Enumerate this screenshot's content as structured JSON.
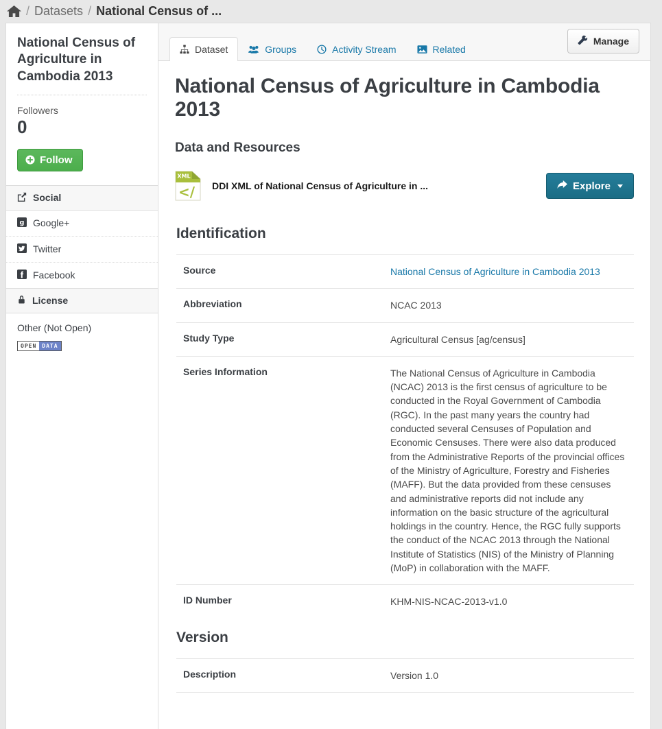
{
  "breadcrumb": {
    "home_icon": "home-icon",
    "separator": "/",
    "datasets_label": "Datasets",
    "current_label": "National Census of ..."
  },
  "sidebar": {
    "title": "National Census of Agriculture in Cambodia 2013",
    "followers_label": "Followers",
    "followers_count": "0",
    "follow_button": "Follow",
    "follow_icon": "plus-circle-icon",
    "social": {
      "heading": "Social",
      "heading_icon": "share-icon",
      "links": [
        {
          "label": "Google+",
          "icon": "google-plus-icon"
        },
        {
          "label": "Twitter",
          "icon": "twitter-icon"
        },
        {
          "label": "Facebook",
          "icon": "facebook-icon"
        }
      ]
    },
    "license": {
      "heading": "License",
      "heading_icon": "lock-icon",
      "name": "Other (Not Open)",
      "badge_open": "OPEN",
      "badge_data": "DATA"
    }
  },
  "tabs": [
    {
      "label": "Dataset",
      "icon": "sitemap-icon",
      "active": true
    },
    {
      "label": "Groups",
      "icon": "users-icon",
      "active": false
    },
    {
      "label": "Activity Stream",
      "icon": "clock-icon",
      "active": false
    },
    {
      "label": "Related",
      "icon": "image-icon",
      "active": false
    }
  ],
  "manage_button": {
    "label": "Manage",
    "icon": "wrench-icon"
  },
  "main": {
    "page_title": "National Census of Agriculture in Cambodia 2013",
    "resources_heading": "Data and Resources",
    "resource": {
      "icon": "xml-file-icon",
      "icon_label": "XML",
      "icon_glyph": "</",
      "title": "DDI XML of National Census of Agriculture in ...",
      "explore_label": "Explore",
      "explore_icon": "share-arrow-icon"
    },
    "sections": [
      {
        "heading": "Identification",
        "rows": [
          {
            "label": "Source",
            "value": "National Census of Agriculture in Cambodia 2013",
            "is_link": true
          },
          {
            "label": "Abbreviation",
            "value": "NCAC 2013",
            "is_link": false
          },
          {
            "label": "Study Type",
            "value": "Agricultural Census [ag/census]",
            "is_link": false
          },
          {
            "label": "Series Information",
            "value": "The National Census of Agriculture in Cambodia (NCAC) 2013 is the first census of agriculture to be conducted in the Royal Government of Cambodia (RGC). In the past many years the country had conducted several Censuses of Population and Economic Censuses. There were also data produced from the Administrative Reports of the provincial offices of the Ministry of Agriculture, Forestry and Fisheries (MAFF). But the data provided from these censuses and administrative reports did not include any information on the basic structure of the agricultural holdings in the country. Hence, the RGC fully supports the conduct of the NCAC 2013 through the National Institute of Statistics (NIS) of the Ministry of Planning (MoP) in collaboration with the MAFF.",
            "is_link": false
          },
          {
            "label": "ID Number",
            "value": "KHM-NIS-NCAC-2013-v1.0",
            "is_link": false
          }
        ]
      },
      {
        "heading": "Version",
        "rows": [
          {
            "label": "Description",
            "value": "Version 1.0",
            "is_link": false
          }
        ]
      }
    ]
  },
  "colors": {
    "link": "#1878a8",
    "explore_button": "#1b6d85",
    "follow_button": "#4cae4c",
    "badge_blue": "#6d83c8",
    "page_bg": "#e8e8e8"
  }
}
